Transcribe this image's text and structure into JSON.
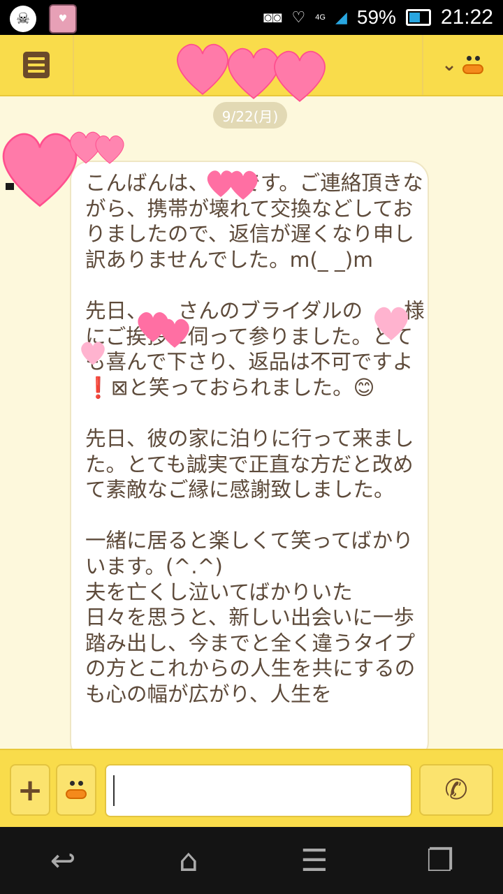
{
  "status_bar": {
    "network": "4G",
    "battery_percent": "59%",
    "battery_level": 0.59,
    "time": "21:22"
  },
  "header": {
    "menu_icon": "menu-list-icon",
    "friend_icon": "friend-duck-icon"
  },
  "chat": {
    "date_divider": "9/22(月)",
    "message": "こんばんは、　　です。ご連絡頂きながら、携帯が壊れて交換などしておりましたので、返信が遅くなり申し訳ありませんでした。m(_ _)m\n\n先日、　　さんのブライダルの　　様にご挨拶に伺って参りました。とても喜んで下さり、返品は不可ですよ❗️⊠と笑っておられました。😊\n\n先日、彼の家に泊りに行って来ました。とても誠実で正直な方だと改めて素敵なご縁に感謝致しました。\n\n一緒に居ると楽しくて笑ってばかりいます。(^.^)\n夫を亡くし泣いてばかりいた\n日々を思うと、新しい出会いに一歩踏み出し、今までと全く違うタイプの方とこれからの人生を共にするのも心の幅が広がり、人生を"
  },
  "input_bar": {
    "plus_label": "+",
    "input_value": "",
    "call_icon": "phone-icon"
  },
  "nav": {
    "back_icon": "back-icon",
    "home_icon": "home-icon",
    "menu_icon": "menu-icon",
    "recent_icon": "recent-apps-icon"
  },
  "colors": {
    "header": "#f9dc4b",
    "background": "#fdf8dc",
    "text": "#5d4a3a",
    "heart": "#ff6fa3"
  }
}
